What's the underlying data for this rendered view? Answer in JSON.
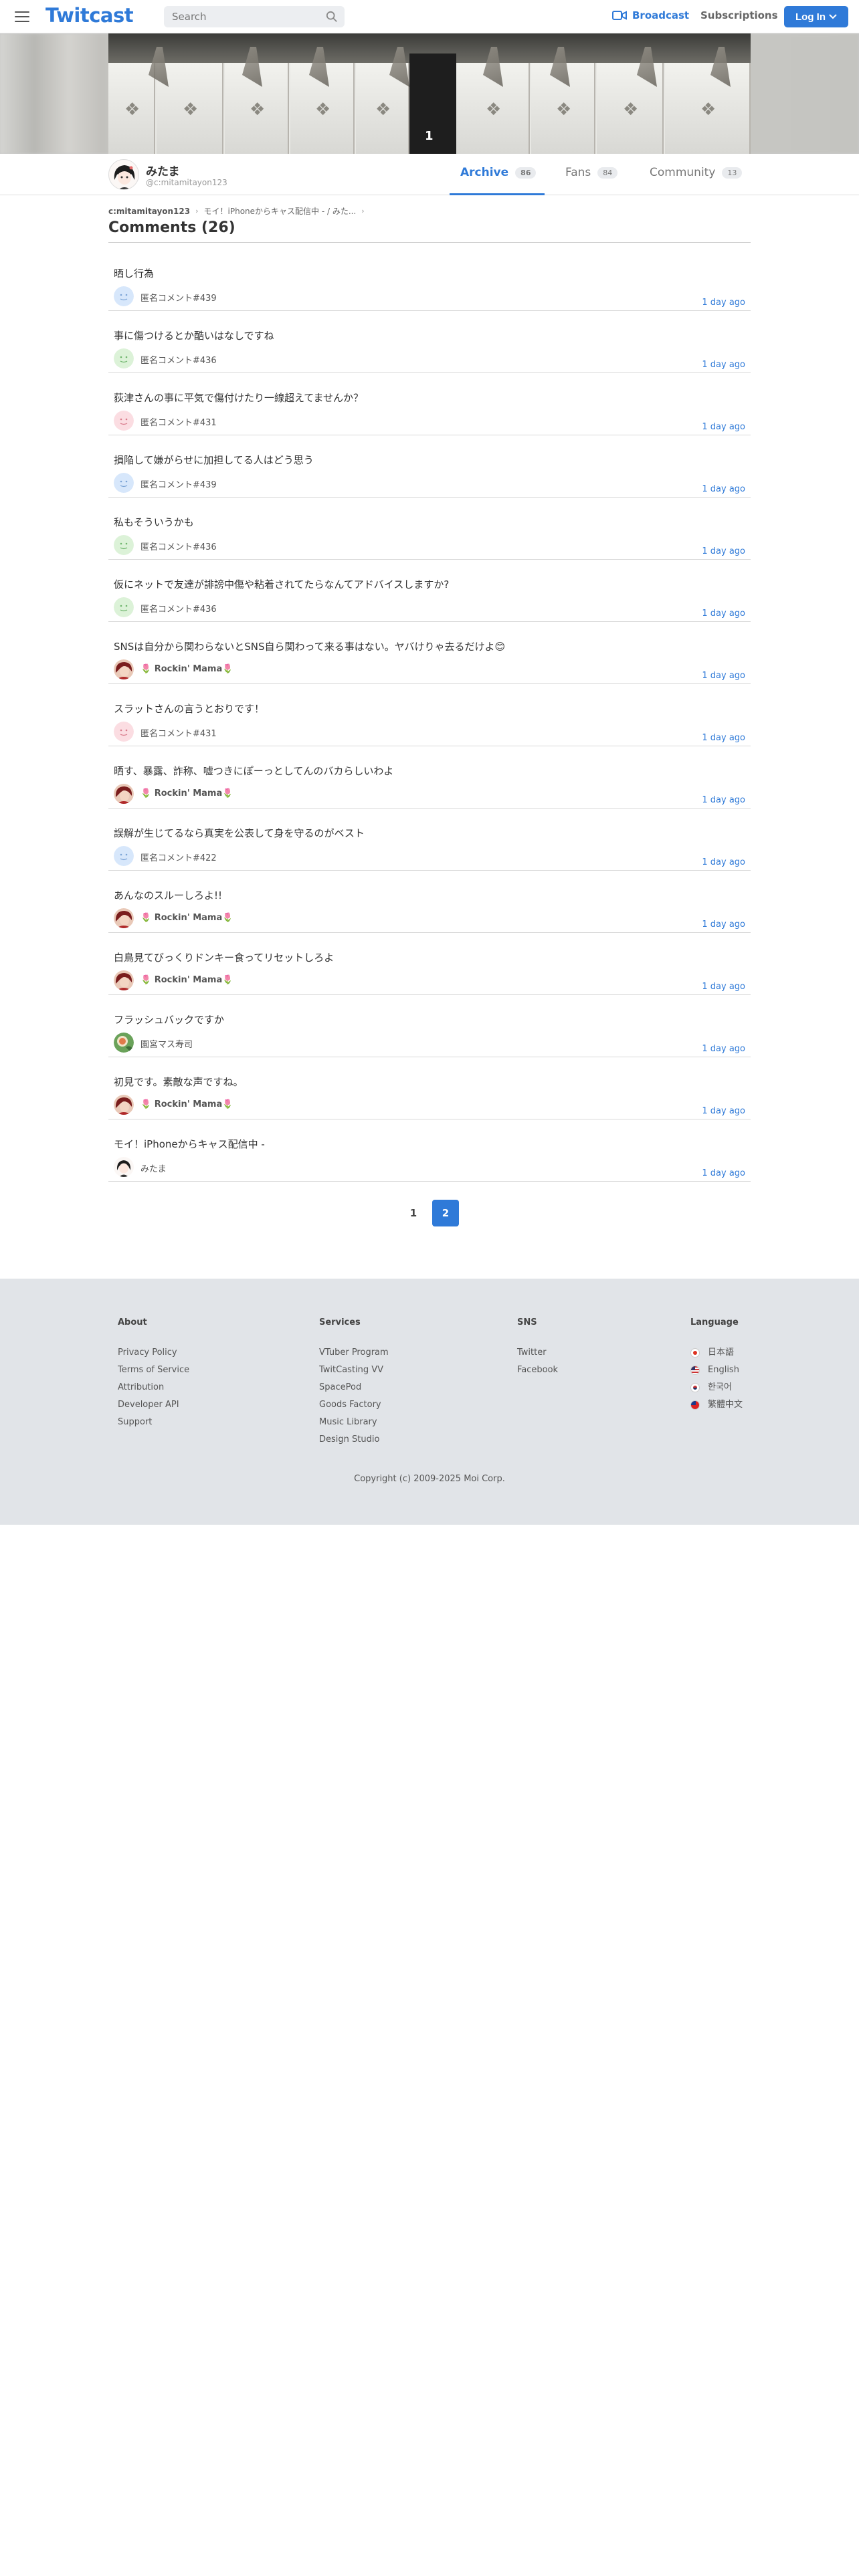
{
  "header": {
    "logo": "Twitcast",
    "search_placeholder": "Search",
    "broadcast_label": "Broadcast",
    "subscriptions_label": "Subscriptions",
    "login_label": "Log In"
  },
  "cover": {
    "overlay_number": "1"
  },
  "profile": {
    "name": "みたま",
    "handle": "@c:mitamitayon123"
  },
  "tabs": [
    {
      "label": "Archive",
      "count": "86"
    },
    {
      "label": "Fans",
      "count": "84"
    },
    {
      "label": "Community",
      "count": "13"
    }
  ],
  "breadcrumb": {
    "user": "c:mitamitayon123",
    "live_title": "モイ！iPhoneからキャス配信中 - / みた..."
  },
  "page_title": "Comments (26)",
  "comments": [
    {
      "text": "晒し行為",
      "user": "匿名コメント#439",
      "time": "1 day ago",
      "avatar": "blue"
    },
    {
      "text": "事に傷つけるとか酷いはなしですね",
      "user": "匿名コメント#436",
      "time": "1 day ago",
      "avatar": "green"
    },
    {
      "text": "荻津さんの事に平気で傷付けたり一線超えてませんか？",
      "user": "匿名コメント#431",
      "time": "1 day ago",
      "avatar": "pink"
    },
    {
      "text": "損陥して嫌がらせに加担してる人はどう思う",
      "user": "匿名コメント#439",
      "time": "1 day ago",
      "avatar": "blue"
    },
    {
      "text": "私もそういうかも",
      "user": "匿名コメント#436",
      "time": "1 day ago",
      "avatar": "green"
    },
    {
      "text": "仮にネットで友達が誹謗中傷や粘着されてたらなんてアドバイスしますか?",
      "user": "匿名コメント#436",
      "time": "1 day ago",
      "avatar": "green"
    },
    {
      "text": "SNSは自分から関わらないとSNS自ら関わって来る事はない。ヤバけりゃ去るだけよ😊",
      "user": "🌷 Rockin' Mama🌷",
      "time": "1 day ago",
      "avatar": "mama"
    },
    {
      "text": "スラットさんの言うとおりです！",
      "user": "匿名コメント#431",
      "time": "1 day ago",
      "avatar": "pink"
    },
    {
      "text": "晒す、暴露、詐称、嘘つきにぽーっとしてんのバカらしいわよ",
      "user": "🌷 Rockin' Mama🌷",
      "time": "1 day ago",
      "avatar": "mama"
    },
    {
      "text": "誤解が生じてるなら真実を公表して身を守るのがベスト",
      "user": "匿名コメント#422",
      "time": "1 day ago",
      "avatar": "blue"
    },
    {
      "text": "あんなのスルーしろよ!!",
      "user": "🌷 Rockin' Mama🌷",
      "time": "1 day ago",
      "avatar": "mama"
    },
    {
      "text": "白鳥見てびっくりドンキー食ってリセットしろよ",
      "user": "🌷 Rockin' Mama🌷",
      "time": "1 day ago",
      "avatar": "mama"
    },
    {
      "text": "フラッシュバックですか",
      "user": "園宮マス寿司",
      "time": "1 day ago",
      "avatar": "sushi"
    },
    {
      "text": "初見です。素敵な声ですね。",
      "user": "🌷 Rockin' Mama🌷",
      "time": "1 day ago",
      "avatar": "mama"
    },
    {
      "text": "モイ！iPhoneからキャス配信中 -",
      "user": "みたま",
      "time": "1 day ago",
      "avatar": "mitama"
    }
  ],
  "pagination": {
    "page1": "1",
    "page2": "2"
  },
  "footer": {
    "about": {
      "title": "About",
      "links": [
        "Privacy Policy",
        "Terms of Service",
        "Attribution",
        "Developer API",
        "Support"
      ]
    },
    "services": {
      "title": "Services",
      "links": [
        "VTuber Program",
        "TwitCasting VV",
        "SpacePod",
        "Goods Factory",
        "Music Library",
        "Design Studio"
      ]
    },
    "sns": {
      "title": "SNS",
      "links": [
        "Twitter",
        "Facebook"
      ]
    },
    "language": {
      "title": "Language",
      "links": [
        "日本語",
        "English",
        "한국어",
        "繁體中文"
      ]
    },
    "copyright": "Copyright (c) 2009-2025 Moi Corp."
  },
  "colors": {
    "accent": "#2f7ad8",
    "footer_bg": "#e1e4e8"
  }
}
